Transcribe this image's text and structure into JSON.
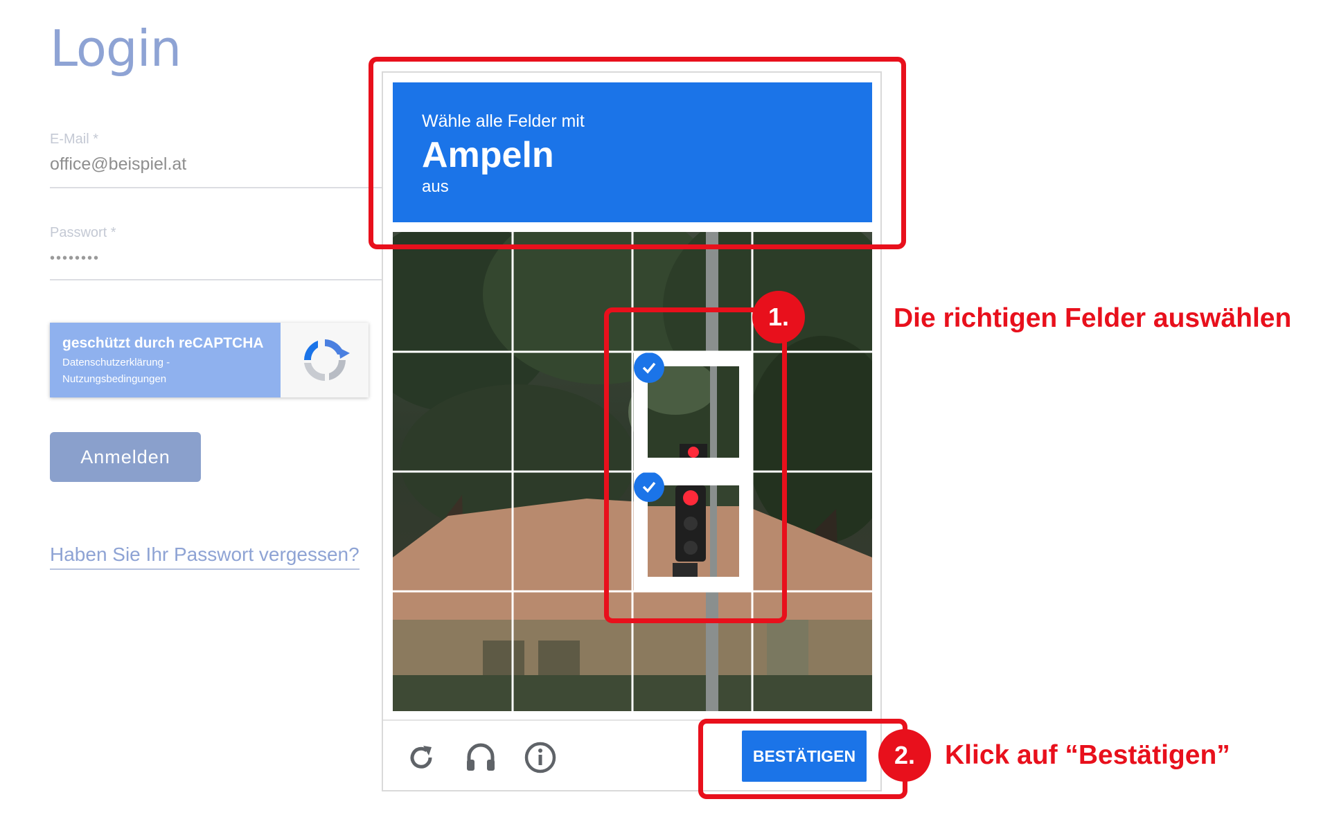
{
  "login": {
    "title": "Login",
    "email_label": "E-Mail *",
    "email_value": "office@beispiel.at",
    "password_label": "Passwort *",
    "password_value": "••••••••",
    "recaptcha_title": "geschützt durch reCAPTCHA",
    "recaptcha_links_line1": "Datenschutzerklärung -",
    "recaptcha_links_line2": "Nutzungsbedingungen",
    "submit_label": "Anmelden",
    "forgot_link": "Haben Sie Ihr Passwort vergessen?"
  },
  "challenge": {
    "prompt_line1": "Wähle alle Felder mit",
    "prompt_keyword": "Ampeln",
    "prompt_line3": "aus",
    "grid": {
      "rows": 4,
      "cols": 4,
      "selected_tiles": [
        [
          1,
          2
        ],
        [
          2,
          2
        ]
      ]
    },
    "footer_icons": [
      "reload-icon",
      "headphones-icon",
      "info-icon"
    ],
    "verify_label": "BESTÄTIGEN"
  },
  "annotations": {
    "step1_number": "1.",
    "step1_text": "Die richtigen Felder auswählen",
    "step2_number": "2.",
    "step2_text": "Klick auf “Bestätigen”"
  },
  "colors": {
    "accent_blue": "#1b74e8",
    "annotation_red": "#e8101c",
    "login_blue": "#8ea3d4"
  }
}
